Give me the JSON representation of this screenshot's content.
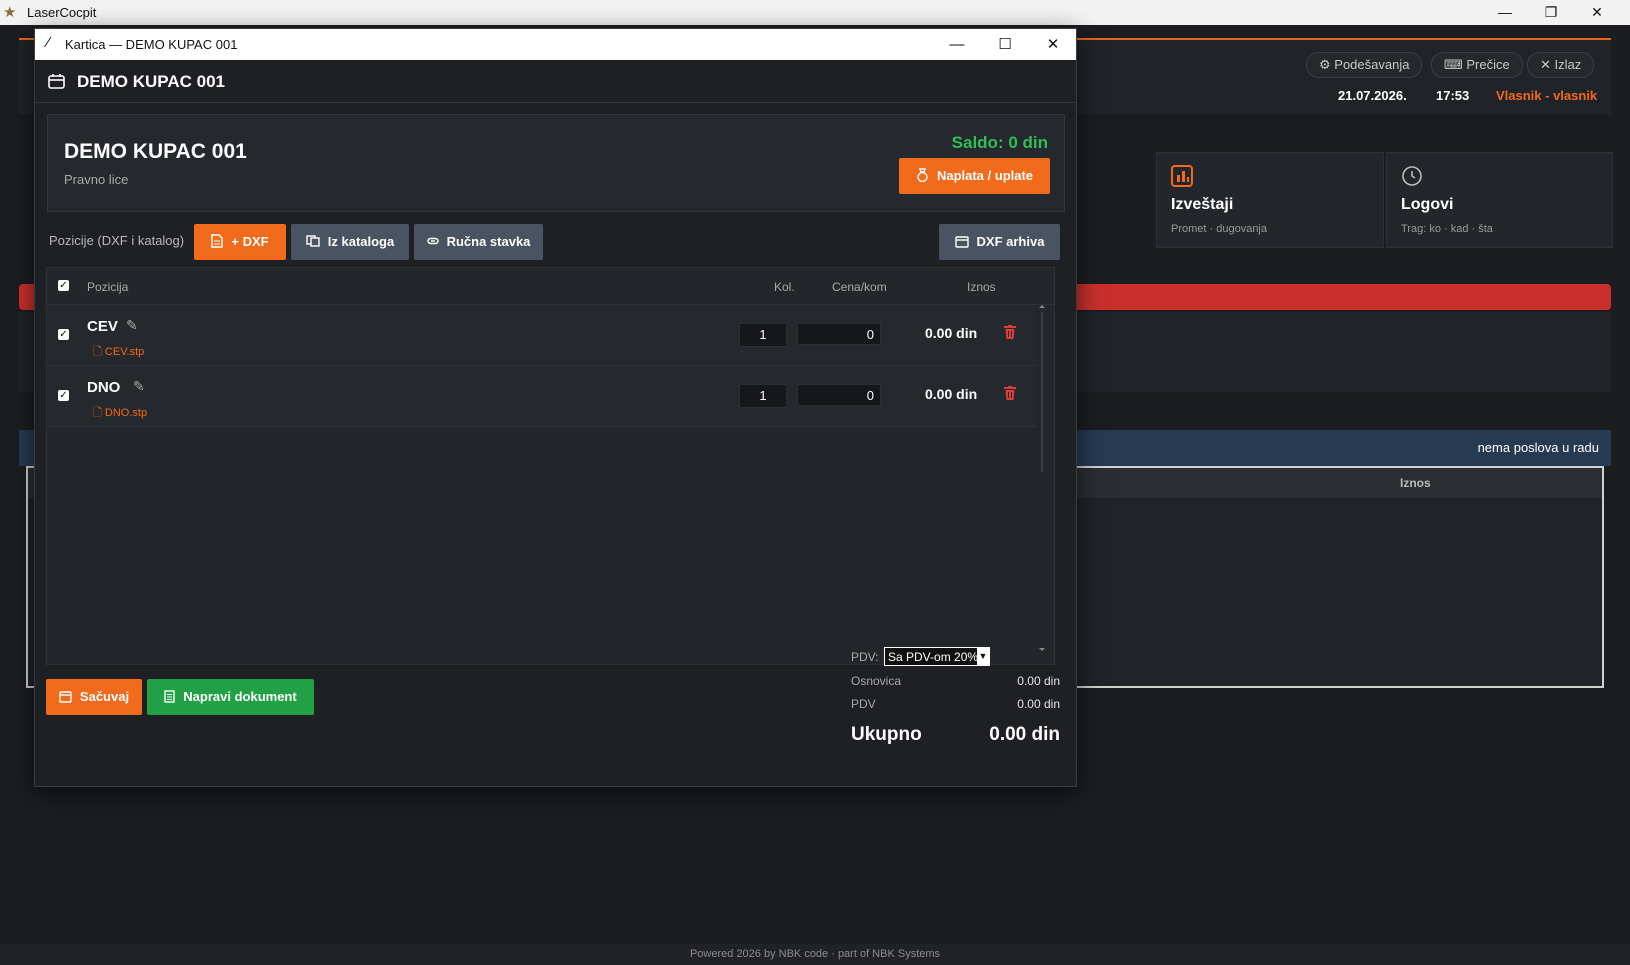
{
  "os": {
    "app_title": "LaserCocpit",
    "min_icon": "minimize-icon",
    "restore_icon": "restore-icon",
    "close_icon": "close-icon"
  },
  "bg": {
    "header_buttons": [
      {
        "label": "Podešavanja",
        "icon": "gear-icon"
      },
      {
        "label": "Prečice",
        "icon": "keyboard-icon"
      },
      {
        "label": "Izlaz",
        "icon": "close-icon"
      }
    ],
    "date": "21.07.2026.",
    "time": "17:53",
    "user": "Vlasnik - vlasnik",
    "cards": [
      {
        "title": "Izveštaji",
        "subtitle": "Promet · dugovanja",
        "icon": "chart-icon"
      },
      {
        "title": "Logovi",
        "subtitle": "Trag: ko · kad · šta",
        "icon": "clock-icon"
      }
    ],
    "jobs_status": "nema poslova u radu",
    "table_header": "Iznos",
    "footer": "Powered 2026 by NBK code  ·  part of NBK Systems"
  },
  "dialog": {
    "window_title": "Kartica — DEMO KUPAC 001",
    "header_title": "DEMO KUPAC 001",
    "customer": {
      "name": "DEMO KUPAC 001",
      "type": "Pravno lice",
      "saldo": "Saldo: 0 din",
      "pay_button": "Naplata / uplate"
    },
    "positions_label": "Pozicije (DXF i katalog)",
    "toolbar": {
      "add_dxf": "+ DXF",
      "from_catalog": "Iz kataloga",
      "manual_item": "Ručna stavka",
      "dxf_archive": "DXF arhiva"
    },
    "table": {
      "headers": {
        "position": "Pozicija",
        "qty": "Kol.",
        "price": "Cena/kom",
        "amount": "Iznos"
      },
      "rows": [
        {
          "name": "CEV",
          "file": "CEV.stp",
          "qty": "1",
          "price": "0",
          "amount": "0.00 din",
          "checked": true
        },
        {
          "name": "DNO",
          "file": "DNO.stp",
          "qty": "1",
          "price": "0",
          "amount": "0.00 din",
          "checked": true
        }
      ]
    },
    "footer": {
      "save": "Sačuvaj",
      "make_document": "Napravi dokument",
      "pdv_label": "PDV:",
      "pdv_option": "Sa PDV-om 20%",
      "base_label": "Osnovica",
      "base_value": "0.00 din",
      "vat_label": "PDV",
      "vat_value": "0.00 din",
      "total_label": "Ukupno",
      "total_value": "0.00 din"
    }
  },
  "colors": {
    "accent": "#f26a1b",
    "success": "#21a045",
    "saldo": "#2fbf5a",
    "danger": "#c9302c",
    "bg": "#1b1d21"
  }
}
